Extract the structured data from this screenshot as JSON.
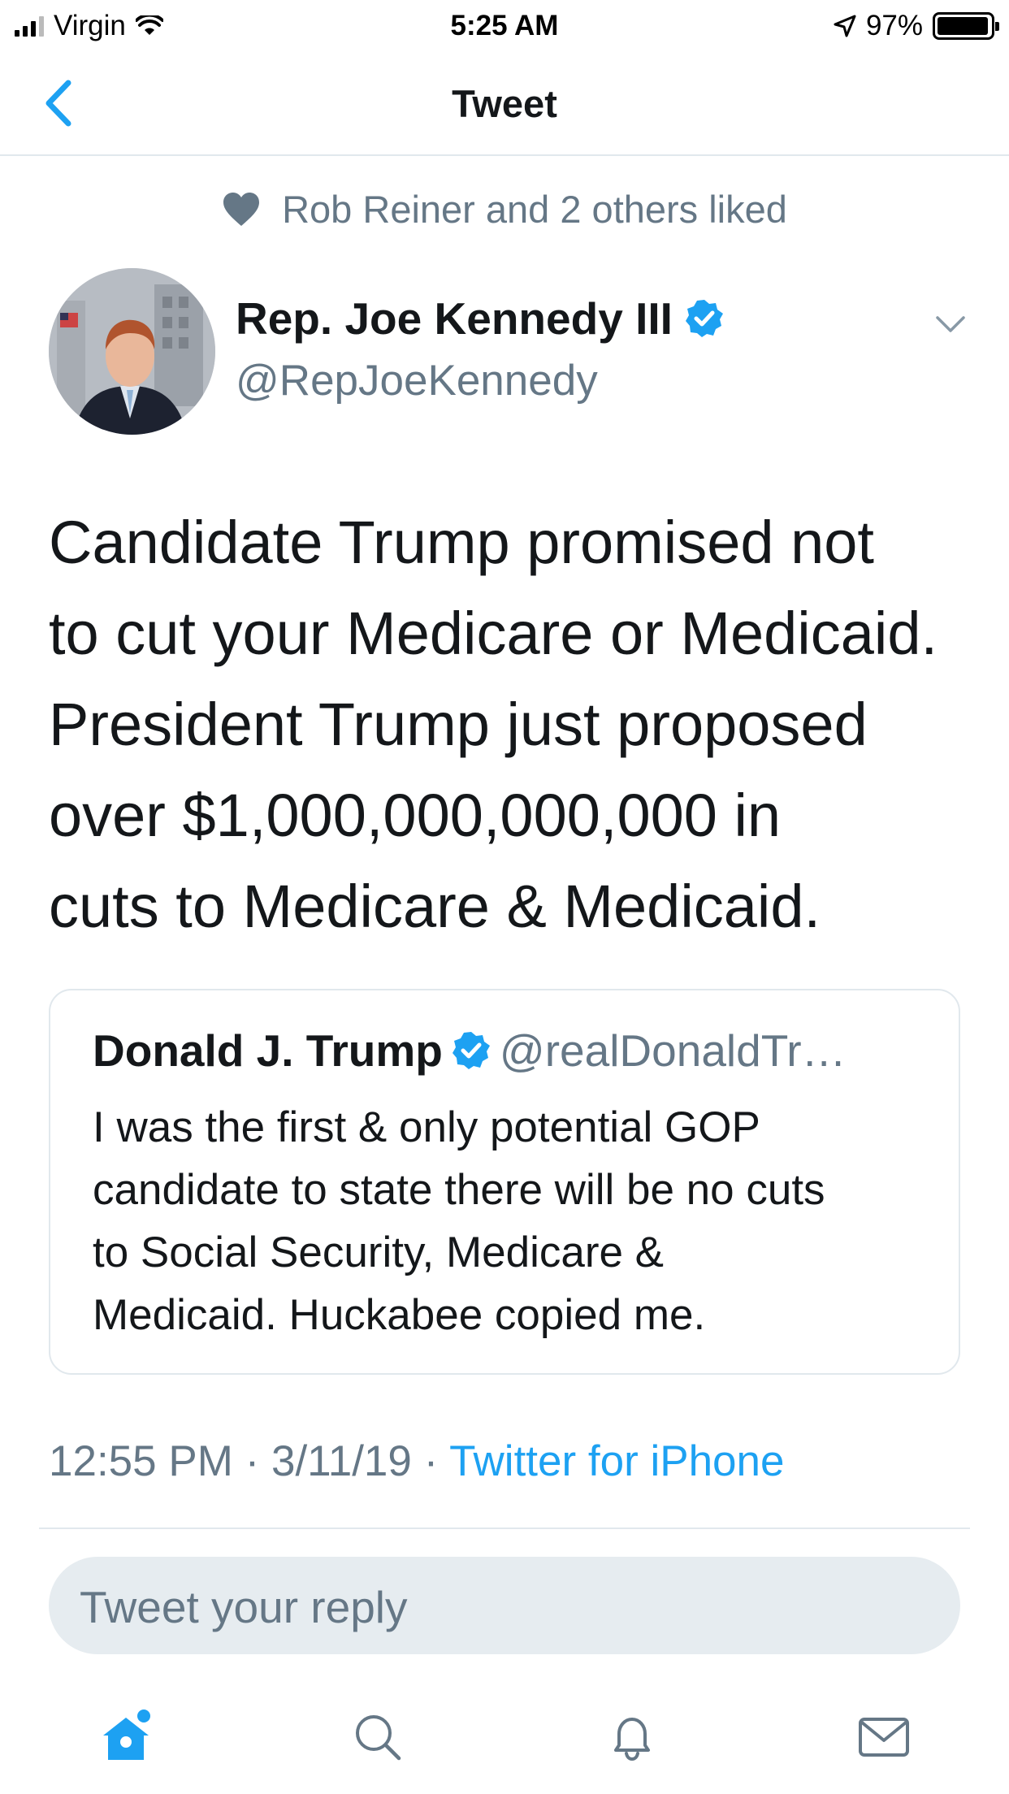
{
  "status_bar": {
    "carrier": "Virgin",
    "time": "5:25 AM",
    "battery_percent": "97%",
    "battery_level": 0.97
  },
  "nav": {
    "title": "Tweet",
    "back_icon": "chevron-left-icon"
  },
  "social_context": {
    "icon": "heart-icon",
    "text": "Rob Reiner and 2 others liked"
  },
  "tweet": {
    "author_name": "Rep. Joe Kennedy III",
    "author_handle": "@RepJoeKennedy",
    "verified": true,
    "text": "Candidate Trump promised not\nto cut your Medicare or Medicaid.\nPresident Trump just proposed\nover $1,000,000,000,000 in\ncuts to Medicare & Medicaid.",
    "time": "12:55 PM",
    "separator": "·",
    "date": "3/11/19",
    "source": "Twitter for iPhone"
  },
  "quoted_tweet": {
    "author_name": "Donald J. Trump",
    "author_handle": "@realDonaldTr…",
    "verified": true,
    "text": "I was the first & only potential GOP\ncandidate to state there will be no cuts\nto Social Security, Medicare &\nMedicaid. Huckabee copied me."
  },
  "reply": {
    "placeholder": "Tweet your reply"
  },
  "tab_bar": {
    "items": [
      "home-icon",
      "search-icon",
      "notifications-icon",
      "messages-icon"
    ],
    "active": "home-icon"
  },
  "colors": {
    "accent": "#1da1f2",
    "secondary_text": "#657786",
    "primary_text": "#14171a",
    "border": "#e1e8ed",
    "reply_bg": "#e6ecf0"
  }
}
